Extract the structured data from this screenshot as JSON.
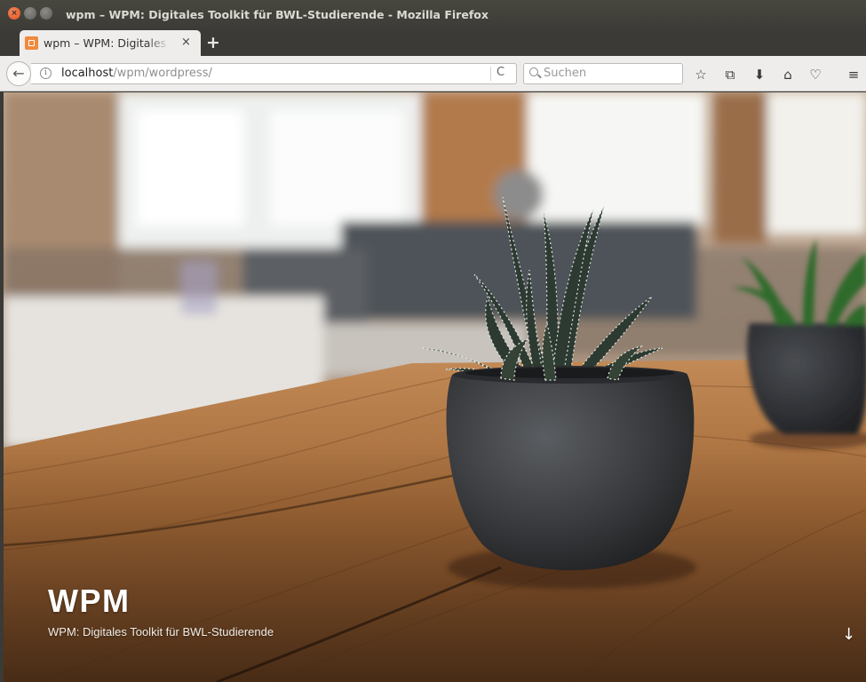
{
  "window": {
    "title": "wpm – WPM: Digitales Toolkit für BWL-Studierende - Mozilla Firefox",
    "close_glyph": "×"
  },
  "tabs": [
    {
      "title": "wpm – WPM: Digitales Toolkit für BWL-Studierende",
      "close_glyph": "×"
    }
  ],
  "new_tab_glyph": "+",
  "navbar": {
    "back_glyph": "←",
    "info_glyph": "i",
    "url_host": "localhost",
    "url_path": "/wpm/wordpress/",
    "reload_glyph": "C",
    "search_placeholder": "Suchen",
    "toolbar_icons": [
      "star-icon",
      "clipboard-icon",
      "download-icon",
      "home-icon",
      "pocket-icon",
      "menu-icon"
    ],
    "toolbar_glyphs": [
      "☆",
      "⧉",
      "⬇",
      "⌂",
      "♡",
      "≡"
    ]
  },
  "site": {
    "title": "WPM",
    "description": "WPM: Digitales Toolkit für BWL-Studierende",
    "scroll_glyph": "↓"
  },
  "colors": {
    "titlebar": "#3c3b37",
    "close_button": "#e3501c",
    "chrome": "#eeedeb",
    "favicon": "#f08a3d"
  }
}
